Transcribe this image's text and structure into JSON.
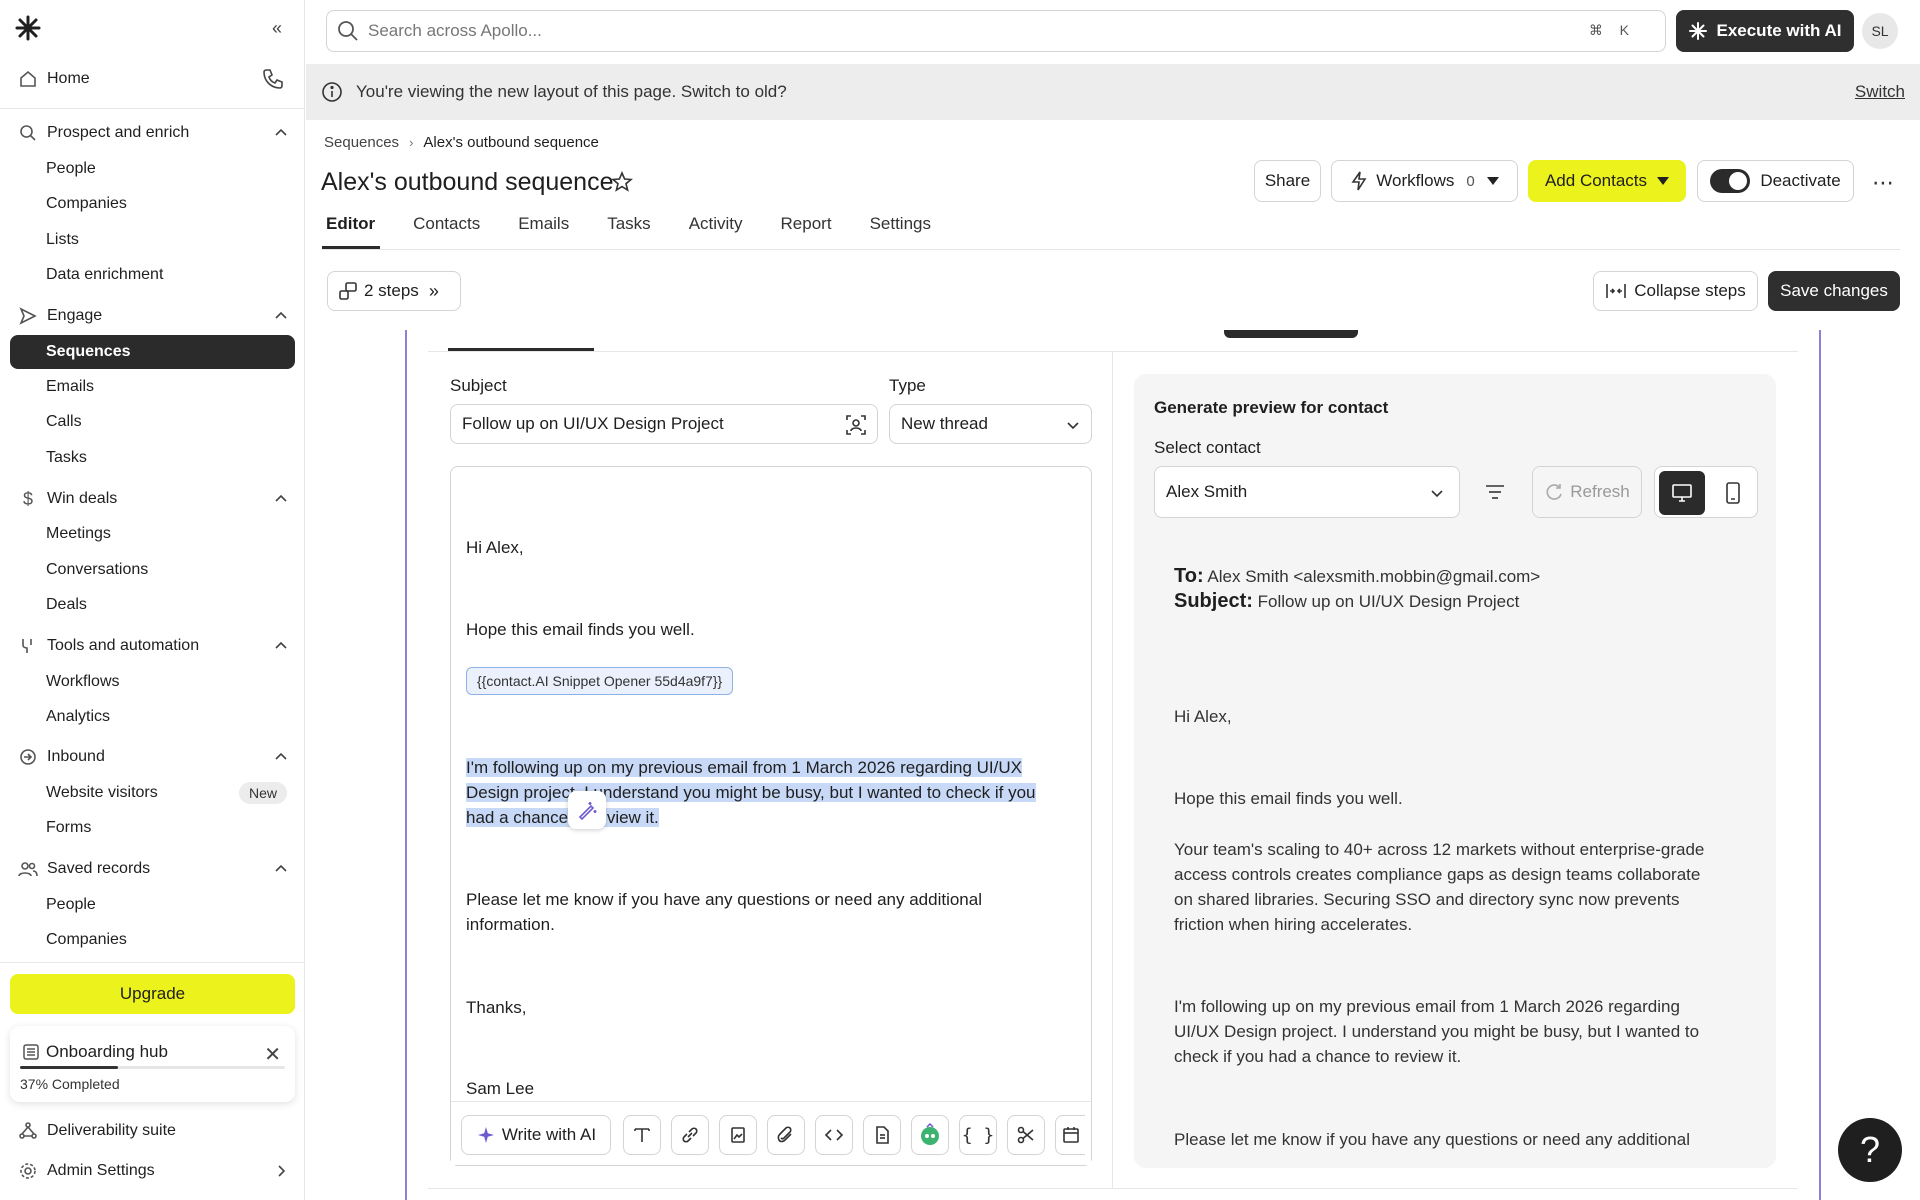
{
  "sidebar": {
    "home": "Home",
    "sections": [
      {
        "label": "Prospect and enrich",
        "items": [
          "People",
          "Companies",
          "Lists",
          "Data enrichment"
        ]
      },
      {
        "label": "Engage",
        "items": [
          "Sequences",
          "Emails",
          "Calls",
          "Tasks"
        ]
      },
      {
        "label": "Win deals",
        "items": [
          "Meetings",
          "Conversations",
          "Deals"
        ]
      },
      {
        "label": "Tools and automation",
        "items": [
          "Workflows",
          "Analytics"
        ]
      },
      {
        "label": "Inbound",
        "items": [
          "Website visitors",
          "Forms"
        ]
      },
      {
        "label": "Saved records",
        "items": [
          "People",
          "Companies"
        ]
      }
    ],
    "new_badge": "New",
    "upgrade": "Upgrade",
    "onboarding": {
      "title": "Onboarding hub",
      "progress_text": "37% Completed",
      "progress": 0.37
    },
    "deliverability": "Deliverability suite",
    "admin": "Admin Settings"
  },
  "topbar": {
    "search_placeholder": "Search across Apollo...",
    "shortcut_cmd": "⌘",
    "shortcut_key": "K",
    "execute_ai": "Execute with AI",
    "avatar": "SL"
  },
  "banner": {
    "text": "You're viewing the new layout of this page. Switch to old?",
    "switch": "Switch"
  },
  "header": {
    "breadcrumb_root": "Sequences",
    "breadcrumb_current": "Alex's outbound sequence",
    "title": "Alex's outbound sequence",
    "share": "Share",
    "workflows": "Workflows",
    "workflows_count": "0",
    "add_contacts": "Add Contacts",
    "deactivate": "Deactivate"
  },
  "tabs": [
    "Editor",
    "Contacts",
    "Emails",
    "Tasks",
    "Activity",
    "Report",
    "Settings"
  ],
  "steps_bar": {
    "steps": "2 steps",
    "collapse": "Collapse steps",
    "save": "Save changes"
  },
  "editor": {
    "subject_label": "Subject",
    "subject_value": "Follow up on UI/UX Design Project",
    "type_label": "Type",
    "type_value": "New thread",
    "greeting": "Hi Alex,",
    "line1": "Hope this email finds you well.",
    "snippet": "{{contact.AI Snippet Opener 55d4a9f7}}",
    "selected_line1": "I'm following up on my previous email from 1 March 2026 regarding UI/UX",
    "selected_line2": "Design project. I understand you might be busy, but I wanted to check if you",
    "selected_line3": "had a chance to review it.",
    "closing1": "Please let me know if you have any questions or need any additional",
    "closing2": "information.",
    "thanks": "Thanks,",
    "signature": "Sam Lee",
    "write_ai": "Write with AI"
  },
  "preview": {
    "title": "Generate preview for contact",
    "select_label": "Select contact",
    "contact": "Alex Smith",
    "refresh": "Refresh",
    "to_label": "To:",
    "to_value": "Alex Smith <alexsmith.mobbin@gmail.com>",
    "subject_label": "Subject:",
    "subject_value": "Follow up on UI/UX Design Project",
    "greeting": "Hi Alex,",
    "line1": "Hope this email finds you well.",
    "para1_1": "Your team's scaling to 40+ across 12 markets without enterprise-grade",
    "para1_2": "access controls creates compliance gaps as design teams collaborate",
    "para1_3": "on shared libraries. Securing SSO and directory sync now prevents",
    "para1_4": "friction when hiring accelerates.",
    "para2_1": "I'm following up on my previous email from 1 March 2026 regarding",
    "para2_2": "UI/UX Design project. I understand you might be busy, but I wanted to",
    "para2_3": "check if you had a chance to review it.",
    "para3_1": "Please let me know if you have any questions or need any additional"
  },
  "help": "?",
  "colors": {
    "accent_yellow": "#ecf21c",
    "dark": "#2b2b2b",
    "highlight": "#c7d9f6",
    "frame_purple": "#8b82d6"
  }
}
